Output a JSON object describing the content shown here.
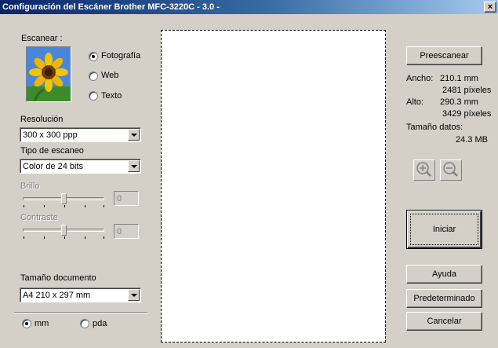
{
  "window": {
    "title": "Configuración del Escáner Brother MFC-3220C - 3.0 -",
    "close_label": "×"
  },
  "scan": {
    "label": "Escanear :",
    "options": [
      {
        "label": "Fotografía",
        "selected": true
      },
      {
        "label": "Web",
        "selected": false
      },
      {
        "label": "Texto",
        "selected": false
      }
    ]
  },
  "resolution": {
    "label": "Resolución",
    "value": "300 x 300 ppp"
  },
  "scan_type": {
    "label": "Tipo de escaneo",
    "value": "Color de 24 bits"
  },
  "brightness": {
    "label": "Brillo",
    "value": "0"
  },
  "contrast": {
    "label": "Contraste",
    "value": "0"
  },
  "doc_size": {
    "label": "Tamaño documento",
    "value": "A4 210 x 297 mm"
  },
  "units": [
    {
      "label": "mm",
      "selected": true
    },
    {
      "label": "pda",
      "selected": false
    }
  ],
  "info": {
    "width_label": "Ancho:",
    "width_mm": "210.1 mm",
    "width_px": "2481 píxeles",
    "height_label": "Alto:",
    "height_mm": "290.3 mm",
    "height_px": "3429 píxeles",
    "size_label": "Tamaño datos:",
    "size_value": "24.3 MB"
  },
  "buttons": {
    "prescan": "Preescanear",
    "start": "Iniciar",
    "help": "Ayuda",
    "default": "Predeterminado",
    "cancel": "Cancelar"
  },
  "icons": {
    "zoom_in": "zoom-in-icon",
    "zoom_out": "zoom-out-icon",
    "photo": "sunflower-photo-icon"
  }
}
